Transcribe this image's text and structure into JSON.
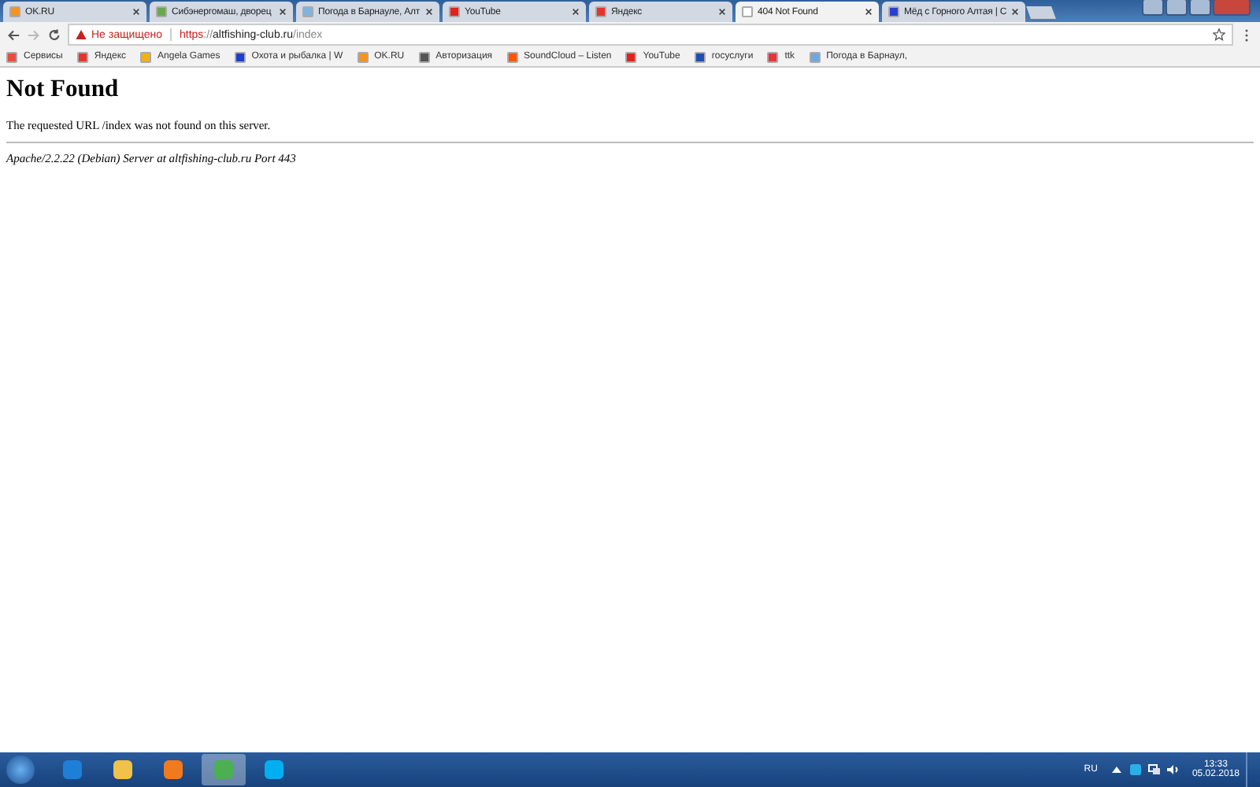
{
  "tabs": [
    {
      "title": "OK.RU",
      "selected": false
    },
    {
      "title": "Сибэнергомаш, дворец",
      "selected": false
    },
    {
      "title": "Погода в Барнауле, Алт",
      "selected": false
    },
    {
      "title": "YouTube",
      "selected": false
    },
    {
      "title": "Яндекс",
      "selected": false
    },
    {
      "title": "404 Not Found",
      "selected": true
    },
    {
      "title": "Мёд с Горного Алтая | С",
      "selected": false
    }
  ],
  "toolbar": {
    "forward_disabled": true,
    "security": "Не защищено",
    "url_parts": [
      "https",
      "://",
      "altfishing-club.ru",
      "/index"
    ]
  },
  "bookmarks": [
    "Сервисы",
    "Яндекс",
    "Angela Games",
    "Охота и рыбалка | W",
    "OK.RU",
    "Авторизация",
    "SoundCloud – Listen",
    "YouTube",
    "госуслуги",
    "ttk",
    "Погода в Барнаул,"
  ],
  "page": {
    "heading": "Not Found",
    "message": "The requested URL /index was not found on this server.",
    "address": "Apache/2.2.22 (Debian) Server at altfishing-club.ru Port 443"
  },
  "taskbar": {
    "apps": [
      {
        "selected": false
      },
      {
        "selected": false
      },
      {
        "selected": false
      },
      {
        "selected": true
      },
      {
        "selected": false
      }
    ],
    "language": "RU",
    "time": "13:33",
    "date": "05.02.2018"
  }
}
